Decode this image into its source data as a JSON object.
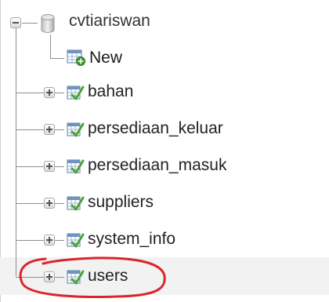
{
  "database": {
    "name": "cvtiariswan",
    "icon": "database-icon"
  },
  "new_item": {
    "label": "New",
    "icon": "new-table-icon"
  },
  "tables": [
    {
      "label": "bahan",
      "icon": "table-icon"
    },
    {
      "label": "persediaan_keluar",
      "icon": "table-icon"
    },
    {
      "label": "persediaan_masuk",
      "icon": "table-icon"
    },
    {
      "label": "suppliers",
      "icon": "table-icon"
    },
    {
      "label": "system_info",
      "icon": "table-icon"
    },
    {
      "label": "users",
      "icon": "table-icon"
    }
  ],
  "annotation": {
    "type": "hand-drawn-circle",
    "target": "users",
    "color": "#d9252b"
  }
}
